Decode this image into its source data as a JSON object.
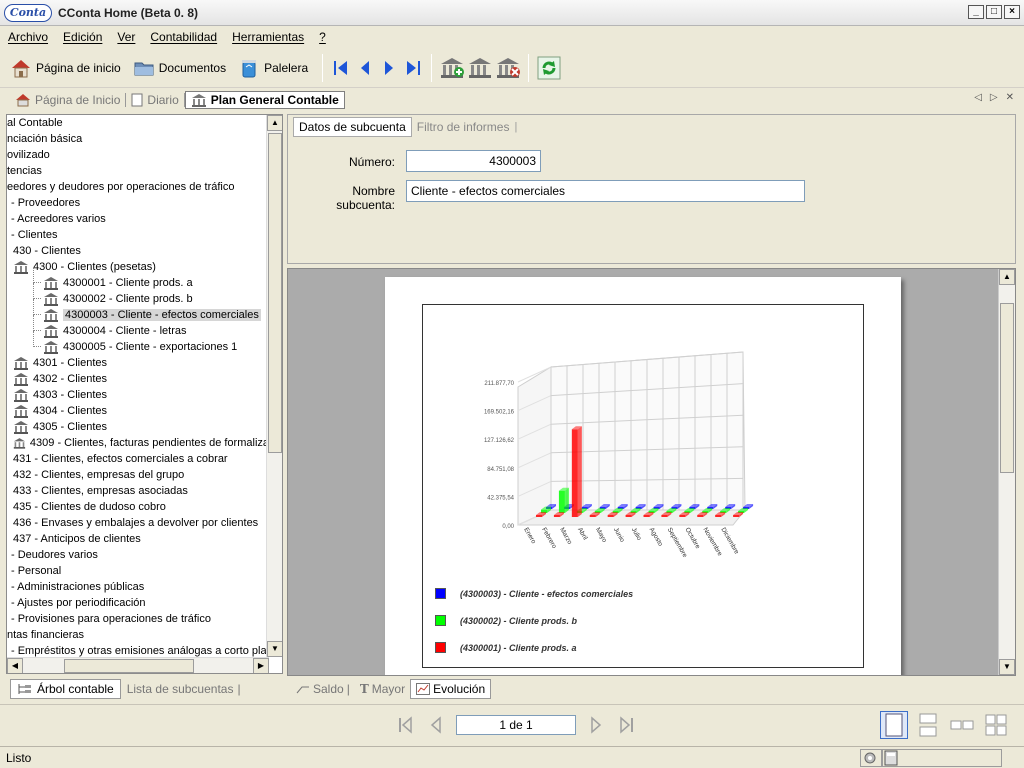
{
  "window": {
    "logo": "Conta",
    "title": "CConta Home (Beta 0. 8)",
    "controls": [
      "_",
      "□",
      "×"
    ]
  },
  "menu": [
    "Archivo",
    "Edición",
    "Ver",
    "Contabilidad",
    "Herramientas",
    "?"
  ],
  "toolbar": {
    "home_label": "Página de inicio",
    "docs_label": "Documentos",
    "trash_label": "Palelera"
  },
  "doc_tabs": [
    {
      "label": "Página de Inicio",
      "icon": "home-icon"
    },
    {
      "label": "Diario",
      "icon": "page-icon"
    },
    {
      "label": "Plan General Contable",
      "icon": "bank-icon"
    }
  ],
  "tree": {
    "items": [
      "al Contable",
      "nciación básica",
      "ovilizado",
      "tencias",
      "eedores y deudores por operaciones de tráfico",
      "- Proveedores",
      "- Acreedores varios",
      "- Clientes",
      "430 - Clientes",
      "4300 - Clientes (pesetas)",
      "4300001 - Cliente prods. a",
      "4300002 - Cliente prods. b",
      "4300003 - Cliente - efectos comerciales",
      "4300004 - Cliente - letras",
      "4300005 - Cliente - exportaciones 1",
      "4301 - Clientes",
      "4302 - Clientes",
      "4303 - Clientes",
      "4304 - Clientes",
      "4305 - Clientes",
      "4309 - Clientes, facturas pendientes de formaliza",
      "431 - Clientes, efectos comerciales a cobrar",
      "432 - Clientes, empresas del grupo",
      "433 - Clientes, empresas asociadas",
      "435 - Clientes de dudoso cobro",
      "436 - Envases y embalajes a devolver por clientes",
      "437 - Anticipos de clientes",
      "- Deudores varios",
      "- Personal",
      "- Administraciones públicas",
      "- Ajustes por periodificación",
      "- Provisiones para operaciones de tráfico",
      "ntas financieras",
      "- Empréstitos y otras emisiones análogas a corto plazo"
    ],
    "selected_index": 12
  },
  "left_tabs": [
    "Árbol contable",
    "Lista de subcuentas"
  ],
  "form": {
    "tabs": [
      "Datos de subcuenta",
      "Filtro de informes"
    ],
    "numero_label": "Número:",
    "numero_value": "4300003",
    "nombre_label": "Nombre subcuenta:",
    "nombre_value": "Cliente - efectos comerciales"
  },
  "viewer_tabs": [
    "Saldo",
    "Mayor",
    "Evolución"
  ],
  "chart_data": {
    "type": "bar",
    "title": "",
    "categories": [
      "Enero",
      "Febrero",
      "Marzo",
      "Abril",
      "Mayo",
      "Junio",
      "Julio",
      "Agosto",
      "Septiembre",
      "Octubre",
      "Noviembre",
      "Diciembre"
    ],
    "ylim": [
      0,
      212000
    ],
    "yticks": [
      "0,00",
      "42.375,54",
      "84.751,08",
      "127.126,62",
      "169.502,16",
      "211.877,70"
    ],
    "series": [
      {
        "name": "(4300003) - Cliente - efectos comerciales",
        "color": "#0000ff",
        "values": [
          0,
          0,
          0,
          0,
          0,
          0,
          0,
          0,
          0,
          0,
          0,
          0
        ]
      },
      {
        "name": "(4300002) - Cliente prods. b",
        "color": "#00ff00",
        "values": [
          5000,
          33000,
          0,
          0,
          0,
          0,
          0,
          0,
          0,
          0,
          0,
          0
        ]
      },
      {
        "name": "(4300001) - Cliente prods. a",
        "color": "#ff0000",
        "values": [
          0,
          0,
          130000,
          0,
          0,
          0,
          0,
          0,
          0,
          0,
          0,
          0
        ]
      }
    ],
    "grid": true,
    "legend": "bottom-left"
  },
  "pager": {
    "page_text": "1 de 1"
  },
  "status": {
    "text": "Listo"
  }
}
